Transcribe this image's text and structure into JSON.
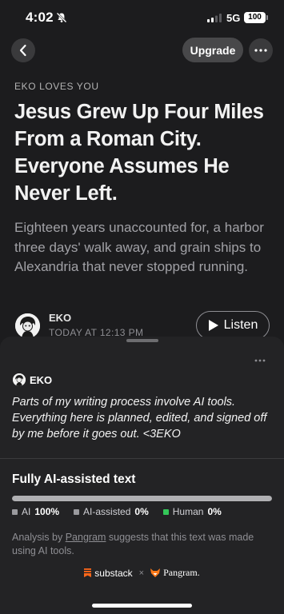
{
  "status_bar": {
    "time": "4:02",
    "network": "5G",
    "battery": "100"
  },
  "nav": {
    "upgrade_label": "Upgrade"
  },
  "article": {
    "publication": "EKO LOVES YOU",
    "title": "Jesus Grew Up Four Miles From a Roman City. Everyone Assumes He Never Left.",
    "subtitle": "Eighteen years unaccounted for, a harbor three days' walk away, and grain ships to Alexandria that never stopped running.",
    "author": "EKO",
    "publish_time": "TODAY AT 12:13 PM",
    "listen_label": "Listen"
  },
  "ai_sheet": {
    "author": "EKO",
    "disclosure": "Parts of my writing process involve AI tools. Everything here is planned, edited, and signed off by me before it goes out. <3EKO",
    "heading": "Fully AI-assisted text",
    "breakdown": {
      "ai_fraction": 1.0,
      "legend": [
        {
          "label": "AI",
          "value": "100%",
          "color": "#9a9a9e"
        },
        {
          "label": "AI-assisted",
          "value": "0%",
          "color": "#9a9a9e"
        },
        {
          "label": "Human",
          "value": "0%",
          "color": "#34c759"
        }
      ]
    },
    "analysis_prefix": "Analysis by ",
    "analysis_link": "Pangram",
    "analysis_suffix": " suggests that this text was made using AI tools.",
    "brand_left": "substack",
    "brand_sep": "×",
    "brand_right": "Pangram."
  }
}
